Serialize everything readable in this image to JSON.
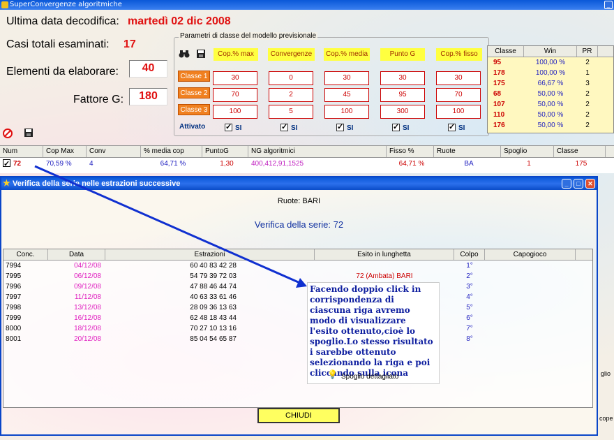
{
  "main_window": {
    "title": "SuperConvergenze algoritmiche",
    "minimize_glyph": "_"
  },
  "info": {
    "last_date_label": "Ultima data decodifica:",
    "last_date_value": "martedì 02 dic 2008",
    "total_cases_label": "Casi totali esaminati:",
    "total_cases_value": "17",
    "elements_label": "Elementi da elaborare:",
    "elements_value": "40",
    "factor_label": "Fattore G:",
    "factor_value": "180"
  },
  "params": {
    "legend": "Parametri di classe del modello previsionale",
    "columns": [
      "Cop.% max",
      "Convergenze",
      "Cop.% media",
      "Punto G",
      "Cop.% fisso"
    ],
    "classes": [
      {
        "label": "Classe 1",
        "values": [
          "30",
          "0",
          "30",
          "30",
          "30"
        ]
      },
      {
        "label": "Classe 2",
        "values": [
          "70",
          "2",
          "45",
          "95",
          "70"
        ]
      },
      {
        "label": "Classe 3",
        "values": [
          "100",
          "5",
          "100",
          "300",
          "100"
        ]
      }
    ],
    "active_label": "Attivato",
    "checkbox_label": "SI"
  },
  "rank_table": {
    "headers": [
      "Classe",
      "Win",
      "PR"
    ],
    "rows": [
      [
        "95",
        "100,00 %",
        "2"
      ],
      [
        "178",
        "100,00 %",
        "1"
      ],
      [
        "175",
        "66,67 %",
        "3"
      ],
      [
        "68",
        "50,00 %",
        "2"
      ],
      [
        "107",
        "50,00 %",
        "2"
      ],
      [
        "110",
        "50,00 %",
        "2"
      ],
      [
        "176",
        "50,00 %",
        "2"
      ]
    ]
  },
  "main_grid": {
    "headers": [
      "Num",
      "Cop Max",
      "Conv",
      "% media cop",
      "PuntoG",
      "NG algoritmici",
      "Fisso %",
      "Ruote",
      "Spoglio",
      "Classe"
    ],
    "row": [
      "72",
      "70,59 %",
      "4",
      "64,71 %",
      "1,30",
      "400,412,91,1525",
      "64,71 %",
      "BA",
      "1",
      "175"
    ]
  },
  "dialog": {
    "title": "Verifica della serie nelle estrazioni successive",
    "ruote": "Ruote: BARI",
    "series": "Verifica della serie: 72",
    "headers": [
      "Conc.",
      "Data",
      "Estrazioni",
      "Esito in lunghetta",
      "Colpo",
      "Capogioco"
    ],
    "rows": [
      [
        "7994",
        "04/12/08",
        "60 40 83 42 28",
        "",
        "1°",
        ""
      ],
      [
        "7995",
        "06/12/08",
        "54 79 39 72 03",
        "72   (Ambata) BARI",
        "2°",
        ""
      ],
      [
        "7996",
        "09/12/08",
        "47 88 46 44 74",
        "",
        "3°",
        ""
      ],
      [
        "7997",
        "11/12/08",
        "40 63 33 61 46",
        "",
        "4°",
        ""
      ],
      [
        "7998",
        "13/12/08",
        "28 09 36 13 63",
        "",
        "5°",
        ""
      ],
      [
        "7999",
        "16/12/08",
        "62 48 18 43 44",
        "",
        "6°",
        ""
      ],
      [
        "8000",
        "18/12/08",
        "70 27 10 13 16",
        "",
        "7°",
        ""
      ],
      [
        "8001",
        "20/12/08",
        "85 04 54 65 87",
        "",
        "8°",
        ""
      ]
    ],
    "close_label": "CHIUDI"
  },
  "annotation": {
    "text": "Facendo doppio click in corrispondenza di ciascuna riga avremo modo di visualizzare l'esito ottenuto,cioè lo spoglio.Lo stesso risultato i sarebbe ottenuto selezionando la riga e poi cliccando sulla icona",
    "button_label": "Spoglio dettagliato"
  },
  "side_fragments": {
    "right_1": "glio",
    "right_2": "cope"
  },
  "colors": {
    "accent_red": "#e01010",
    "title_blue": "#0a58d8",
    "class_orange": "#f08020",
    "header_yellow": "#ffff40"
  }
}
